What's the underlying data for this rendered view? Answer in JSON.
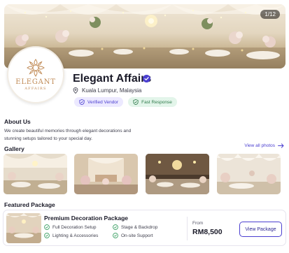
{
  "hero": {
    "photo_counter": "1/12"
  },
  "logo": {
    "name": "ELEGANT",
    "sub": "AFFAIRS"
  },
  "vendor": {
    "name": "Elegant Affairs",
    "location": "Kuala Lumpur, Malaysia",
    "badges": [
      {
        "label": "Verified Vendor"
      },
      {
        "label": "Fast Response"
      }
    ]
  },
  "about": {
    "heading": "About Us",
    "line1": "We create beautiful memories through elegant decorations and",
    "line2": "stunning setups tailored to your special day."
  },
  "gallery": {
    "heading": "Gallery",
    "view_all": "View all photos"
  },
  "featured": {
    "heading": "Featured Package",
    "package": {
      "title": "Premium Decoration Package",
      "features": [
        "Full Decoration Setup",
        "Stage & Backdrop",
        "Lighting & Accessories",
        "On-site Support"
      ],
      "price_label": "From",
      "price": "RM8,500",
      "button": "View Package"
    }
  },
  "colors": {
    "accent": "#4b3fd0",
    "gold": "#c08a55",
    "green": "#2f9a5a"
  }
}
